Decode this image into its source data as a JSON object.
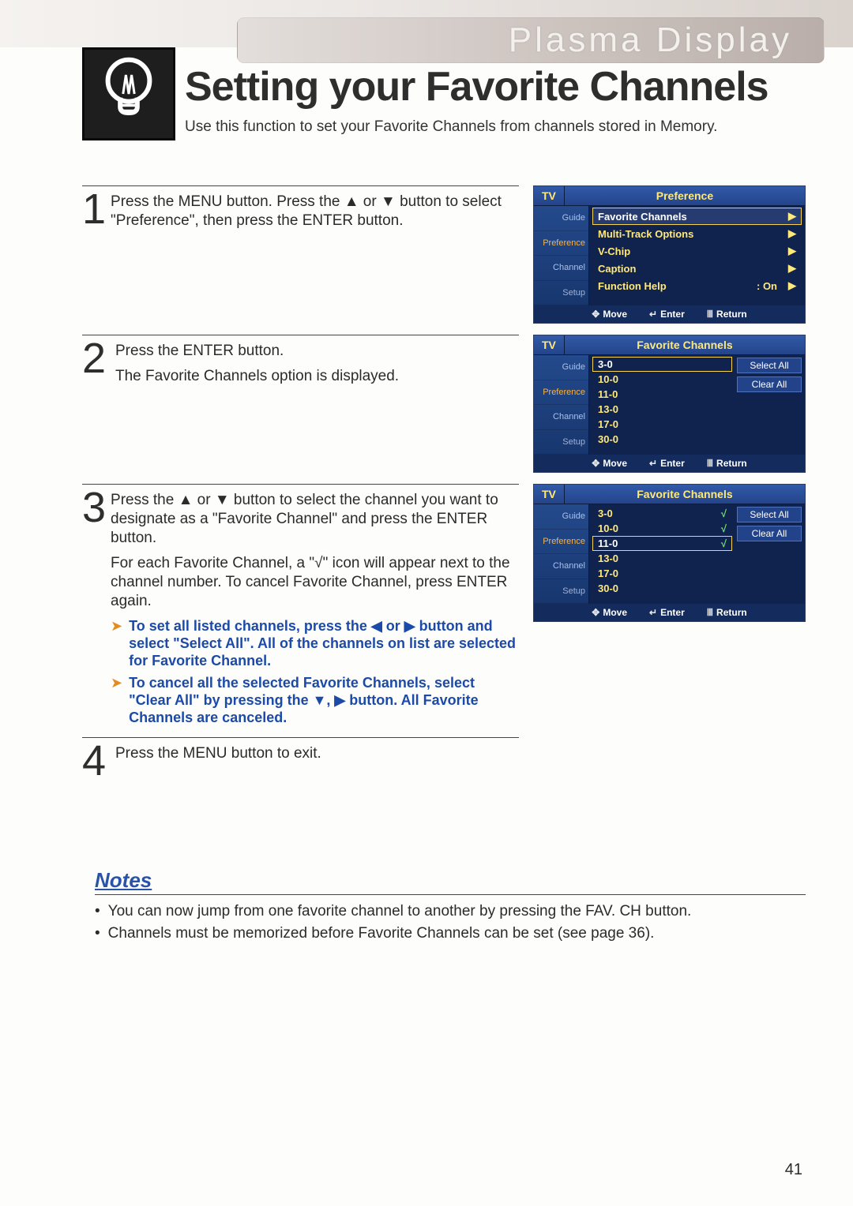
{
  "brand": "Plasma Display",
  "title": "Setting your Favorite Channels",
  "subtitle": "Use this function to set your Favorite Channels from channels stored in Memory.",
  "steps": {
    "s1": {
      "num": "1",
      "text": "Press the MENU button. Press the ▲ or ▼ button to select \"Preference\", then press the ENTER button."
    },
    "s2": {
      "num": "2",
      "line1": "Press the ENTER button.",
      "line2": "The Favorite Channels option is displayed."
    },
    "s3": {
      "num": "3",
      "p1": "Press the ▲ or ▼ button to select the channel you want to designate as a \"Favorite Channel\" and press the ENTER button.",
      "p2": "For each Favorite Channel, a \"√\" icon will appear next to the channel number. To cancel Favorite Channel, press ENTER again.",
      "tip1": "To set all listed channels, press the ◀ or ▶ button and select \"Select All\". All of the channels on list are selected for Favorite Channel.",
      "tip2": "To cancel all the selected Favorite Channels, select \"Clear All\" by pressing the ▼, ▶ button. All Favorite Channels are canceled."
    },
    "s4": {
      "num": "4",
      "text": "Press the MENU button to exit."
    }
  },
  "osd": {
    "tv": "TV",
    "side": {
      "guide": "Guide",
      "preference": "Preference",
      "channel": "Channel",
      "setup": "Setup"
    },
    "foot": {
      "move": "Move",
      "enter": "Enter",
      "ret": "Return"
    }
  },
  "osd1": {
    "title": "Preference",
    "items": {
      "fav": "Favorite Channels",
      "multi": "Multi-Track Options",
      "vchip": "V-Chip",
      "caption": "Caption",
      "func": "Function Help",
      "funcVal": ":  On"
    }
  },
  "osd2": {
    "title": "Favorite Channels",
    "channels": {
      "c0": "3-0",
      "c1": "10-0",
      "c2": "11-0",
      "c3": "13-0",
      "c4": "17-0",
      "c5": "30-0"
    },
    "selectAll": "Select All",
    "clearAll": "Clear All"
  },
  "osd3": {
    "title": "Favorite Channels",
    "channels": {
      "c0": "3-0",
      "c1": "10-0",
      "c2": "11-0",
      "c3": "13-0",
      "c4": "17-0",
      "c5": "30-0"
    },
    "selectAll": "Select All",
    "clearAll": "Clear All"
  },
  "notes": {
    "heading": "Notes",
    "n1": "You can now jump from one favorite channel to another by pressing the FAV. CH button.",
    "n2": "Channels must be memorized before Favorite Channels can be set (see page 36)."
  },
  "pageNumber": "41"
}
